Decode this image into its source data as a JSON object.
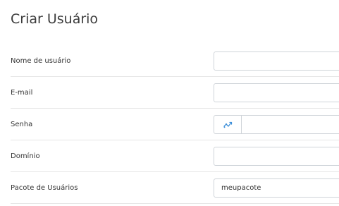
{
  "page": {
    "title": "Criar Usuário"
  },
  "form": {
    "fields": [
      {
        "label": "Nome de usuário",
        "value": ""
      },
      {
        "label": "E-mail",
        "value": ""
      },
      {
        "label": "Senha",
        "value": "",
        "addon_icon": "random-password-icon"
      },
      {
        "label": "Domínio",
        "value": ""
      },
      {
        "label": "Pacote de Usuários",
        "value": "meupacote"
      }
    ]
  },
  "colors": {
    "accent_icon": "#3d8fd9",
    "border": "#cfd4d9",
    "divider": "#e6e6e6"
  }
}
